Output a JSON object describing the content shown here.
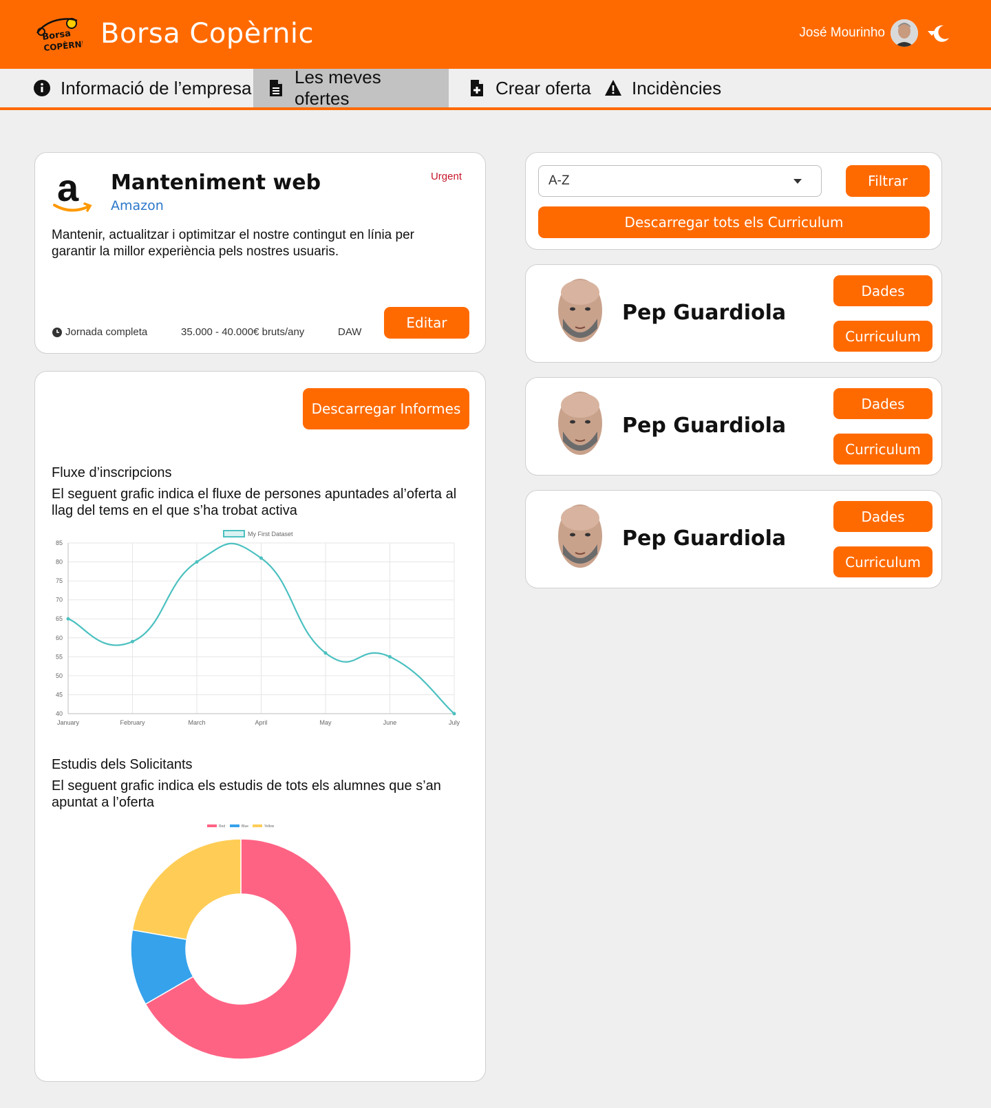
{
  "header": {
    "brand": "Borsa Copèrnic",
    "user_name": "José Mourinho"
  },
  "nav": {
    "items": [
      {
        "label": "Informació de l’empresa",
        "icon": "info-circle-icon"
      },
      {
        "label": "Les meves ofertes",
        "icon": "document-icon",
        "active": true
      },
      {
        "label": "Crear oferta",
        "icon": "document-plus-icon"
      },
      {
        "label": "Incidències",
        "icon": "warning-icon"
      }
    ]
  },
  "offer": {
    "title": "Manteniment web",
    "company": "Amazon",
    "badge": "Urgent",
    "description": "Mantenir, actualitzar i optimitzar el nostre contingut en línia per garantir la millor experiència pels nostres usuaris.",
    "schedule": "Jornada completa",
    "salary": "35.000 - 40.000€ bruts/any",
    "study": "DAW",
    "edit_label": "Editar"
  },
  "reports": {
    "download_label": "Descarregar Informes",
    "flow_title": "Fluxe d’inscripcions",
    "flow_desc": "El seguent grafic indica el fluxe de persones apuntades al’oferta al llag del tems en el que s’ha trobat activa",
    "studies_title": "Estudis dels Solicitants",
    "studies_desc": "El seguent grafic indica els estudis de tots els alumnes que s’an apuntat a l’oferta"
  },
  "chart_data": [
    {
      "type": "line",
      "x": [
        "January",
        "February",
        "March",
        "April",
        "May",
        "June",
        "July"
      ],
      "series": [
        {
          "name": "My First Dataset",
          "values": [
            65,
            59,
            80,
            81,
            56,
            55,
            40
          ]
        }
      ],
      "ylim": [
        40,
        85
      ],
      "yticks": [
        85,
        80,
        75,
        70,
        65,
        60,
        55,
        50,
        45,
        40
      ],
      "grid": true,
      "legend": "top",
      "color": "#4bc0c0"
    },
    {
      "type": "pie",
      "donut": true,
      "categories": [
        "Red",
        "Blue",
        "Yellow"
      ],
      "values": [
        300,
        50,
        100
      ],
      "colors": [
        "#ff6384",
        "#36a2eb",
        "#ffcd56"
      ],
      "legend": "top"
    }
  ],
  "filter": {
    "sort_value": "A-Z",
    "filter_label": "Filtrar",
    "download_all_label": "Descarregar tots els Curriculum"
  },
  "applicants": [
    {
      "name": "Pep Guardiola",
      "data_label": "Dades",
      "cv_label": "Curriculum"
    },
    {
      "name": "Pep Guardiola",
      "data_label": "Dades",
      "cv_label": "Curriculum"
    },
    {
      "name": "Pep Guardiola",
      "data_label": "Dades",
      "cv_label": "Curriculum"
    }
  ],
  "colors": {
    "accent": "#ff6a00",
    "link": "#2a77c9",
    "urgent": "#c6162b",
    "background": "#efefef"
  }
}
